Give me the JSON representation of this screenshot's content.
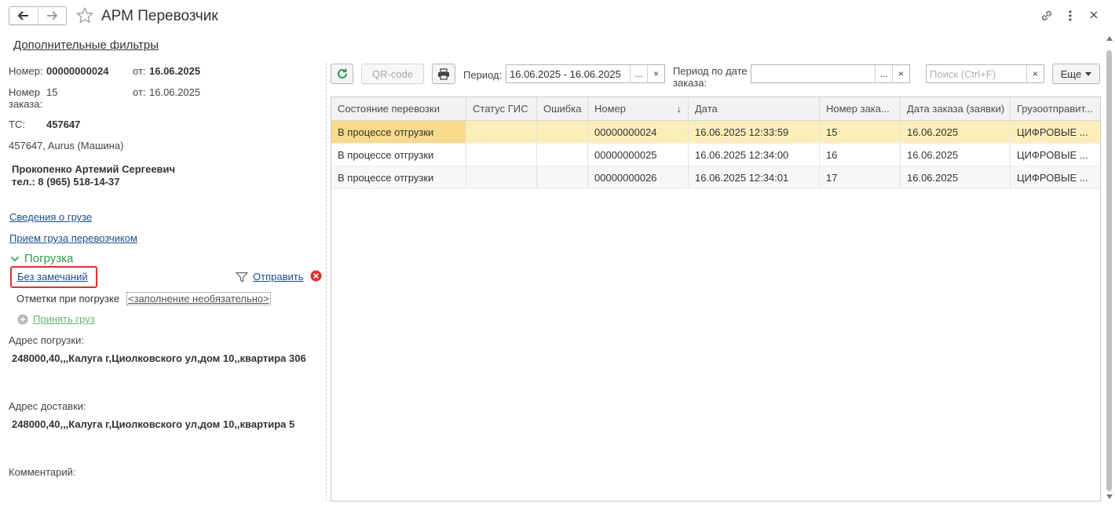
{
  "window": {
    "title": "АРМ Перевозчик",
    "back_icon": "arrow-left-icon",
    "forward_icon": "arrow-right-icon",
    "favorite_icon": "star-icon",
    "link_icon": "link-icon",
    "menu_icon": "more-vertical-icon",
    "close_icon": "close-icon"
  },
  "filters_link": "Дополнительные фильтры",
  "details": {
    "number_label": "Номер:",
    "number_value": "00000000024",
    "number_date_label": "от:",
    "number_date_value": "16.06.2025",
    "order_label": "Номер заказа:",
    "order_value": "15",
    "order_date_label": "от:",
    "order_date_value": "16.06.2025",
    "vehicle_label": "ТС:",
    "vehicle_value": "457647",
    "vehicle_desc": "457647, Aurus (Машина)",
    "driver_name": "Прокопенко Артемий Сергеевич",
    "driver_phone": "тел.: 8 (965) 518-14-37",
    "cargo_info_link": "Сведения о грузе",
    "cargo_accept_link": "Прием груза перевозчиком",
    "loading_group": "Погрузка",
    "no_remarks_link": "Без замечаний",
    "send_link": "Отправить",
    "marks_label": "Отметки при погрузке",
    "marks_value": "<заполнение необязательно>",
    "accept_cargo_link": "Принять груз",
    "loading_address_label": "Адрес погрузки:",
    "loading_address_value": "248000,40,,,Калуга г,Циолковского ул,дом 10,,квартира 306",
    "delivery_address_label": "Адрес доставки:",
    "delivery_address_value": "248000,40,,,Калуга г,Циолковского ул,дом 10,,квартира 5",
    "comment_label": "Комментарий:"
  },
  "toolbar": {
    "refresh_icon": "refresh-icon",
    "qr_label": "QR-code",
    "print_icon": "printer-icon",
    "period_label": "Период:",
    "period_value": "16.06.2025 - 16.06.2025",
    "period_by_order_label": "Период по дате заказа:",
    "period_by_order_value": "",
    "search_placeholder": "Поиск (Ctrl+F)",
    "more_label": "Еще",
    "select_glyph": "...",
    "clear_glyph": "×"
  },
  "table": {
    "columns": [
      "Состояние перевозки",
      "Статус ГИС",
      "Ошибка",
      "Номер",
      "Дата",
      "Номер зака...",
      "Дата заказа (заявки)",
      "Грузоотправит..."
    ],
    "sort_indicator": "↓",
    "rows": [
      [
        "В процессе отгрузки",
        "",
        "",
        "00000000024",
        "16.06.2025 12:33:59",
        "15",
        "16.06.2025",
        "ЦИФРОВЫЕ ..."
      ],
      [
        "В процессе отгрузки",
        "",
        "",
        "00000000025",
        "16.06.2025 12:34:00",
        "16",
        "16.06.2025",
        "ЦИФРОВЫЕ ..."
      ],
      [
        "В процессе отгрузки",
        "",
        "",
        "00000000026",
        "16.06.2025 12:34:01",
        "17",
        "16.06.2025",
        "ЦИФРОВЫЕ ..."
      ]
    ]
  },
  "colors": {
    "accent_green": "#2a9d4a",
    "link_blue": "#1a4d8c",
    "highlight_red": "#e03131",
    "selected_row": "#fbeeb9",
    "selected_cell": "#f8da8c"
  }
}
